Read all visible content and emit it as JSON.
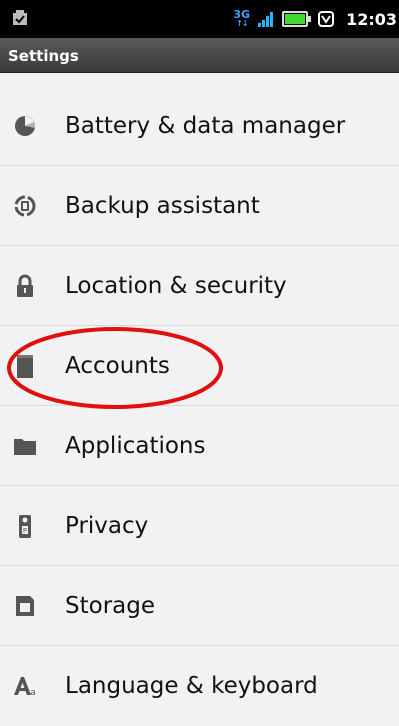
{
  "status_bar": {
    "network_type": "3G",
    "network_arrows": "↑↓",
    "time": "12:03",
    "icons": [
      "sd-card-icon",
      "network-3g-icon",
      "signal-icon",
      "battery-icon",
      "alarm-icon"
    ]
  },
  "title_bar": {
    "title": "Settings"
  },
  "settings": {
    "items": [
      {
        "label": "Battery & data manager",
        "icon": "battery-pie-icon"
      },
      {
        "label": "Backup assistant",
        "icon": "backup-icon"
      },
      {
        "label": "Location & security",
        "icon": "lock-icon"
      },
      {
        "label": "Accounts",
        "icon": "accounts-icon"
      },
      {
        "label": "Applications",
        "icon": "folder-icon"
      },
      {
        "label": "Privacy",
        "icon": "privacy-icon"
      },
      {
        "label": "Storage",
        "icon": "storage-icon"
      },
      {
        "label": "Language & keyboard",
        "icon": "language-icon"
      }
    ]
  },
  "annotation": {
    "type": "red-ellipse",
    "target": "Accounts",
    "color": "#e01010"
  },
  "colors": {
    "background": "#f2f2f2",
    "icon": "#555555",
    "text": "#111111",
    "status_bar": "#000000"
  }
}
